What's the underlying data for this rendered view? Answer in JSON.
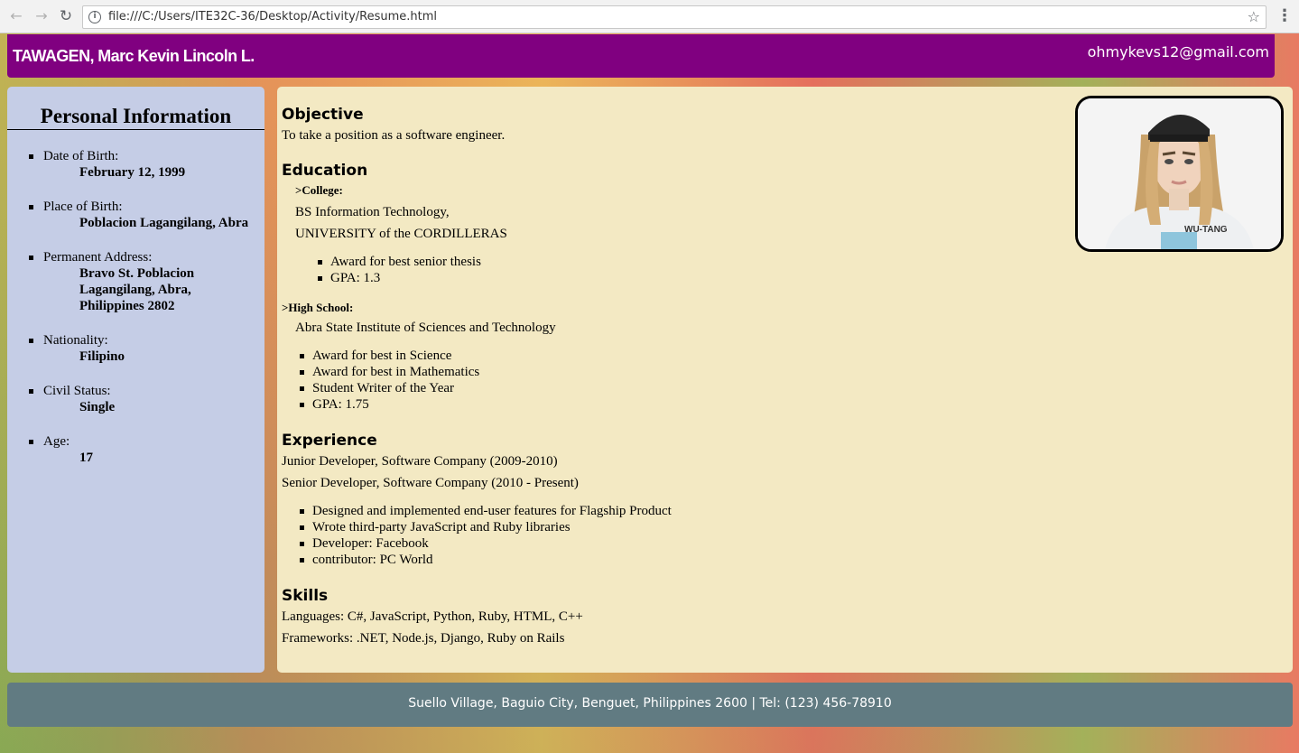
{
  "browser": {
    "url": "file:///C:/Users/ITE32C-36/Desktop/Activity/Resume.html",
    "back_icon": "arrow-left-icon",
    "forward_icon": "arrow-right-icon",
    "reload_icon": "reload-icon",
    "info_icon": "info-icon",
    "star_icon": "star-icon",
    "menu_icon": "kebab-menu-icon"
  },
  "header": {
    "name": "TAWAGEN, Marc Kevin Lincoln L.",
    "email": "ohmykevs12@gmail.com",
    "color": "#800080"
  },
  "sidebar": {
    "title": "Personal Information",
    "items": [
      {
        "label": "Date of Birth:",
        "value_lines": [
          "February 12, 1999"
        ]
      },
      {
        "label": "Place of Birth:",
        "value_lines": [
          "Poblacion Lagangilang, Abra"
        ]
      },
      {
        "label": "Permanent Address:",
        "value_lines": [
          "Bravo St. Poblacion",
          "Lagangilang, Abra,",
          "Philippines 2802"
        ]
      },
      {
        "label": "Nationality:",
        "value_lines": [
          "Filipino"
        ]
      },
      {
        "label": "Civil Status:",
        "value_lines": [
          "Single"
        ]
      },
      {
        "label": "Age:",
        "value_lines": [
          "17"
        ]
      }
    ]
  },
  "main": {
    "objective": {
      "heading": "Objective",
      "text": "To take a position as a software engineer."
    },
    "education": {
      "heading": "Education",
      "college": {
        "label": ">College:",
        "degree": "BS Information Technology,",
        "school": "UNIVERSITY of the CORDILLERAS",
        "bullets": [
          "Award for best senior thesis",
          "GPA: 1.3"
        ]
      },
      "high_school": {
        "label": ">High School:",
        "school": "Abra State Institute of Sciences and Technology",
        "bullets": [
          "Award for best in Science",
          "Award for best in Mathematics",
          "Student Writer of the Year",
          "GPA: 1.75"
        ]
      }
    },
    "experience": {
      "heading": "Experience",
      "jobs": [
        "Junior Developer, Software Company (2009-2010)",
        "Senior Developer, Software Company (2010 - Present)"
      ],
      "bullets": [
        "Designed and implemented end-user features for Flagship Product",
        "Wrote third-party JavaScript and Ruby libraries",
        "Developer: Facebook",
        "contributor: PC World"
      ]
    },
    "skills": {
      "heading": "Skills",
      "languages": "Languages: C#, JavaScript, Python, Ruby, HTML, C++",
      "frameworks": "Frameworks: .NET, Node.js, Django, Ruby on Rails"
    },
    "photo_shirt_text": "WU-TANG"
  },
  "footer": {
    "text": "Suello Village, Baguio City, Benguet, Philippines 2600 | Tel: (123) 456-78910",
    "color": "#617b82"
  }
}
